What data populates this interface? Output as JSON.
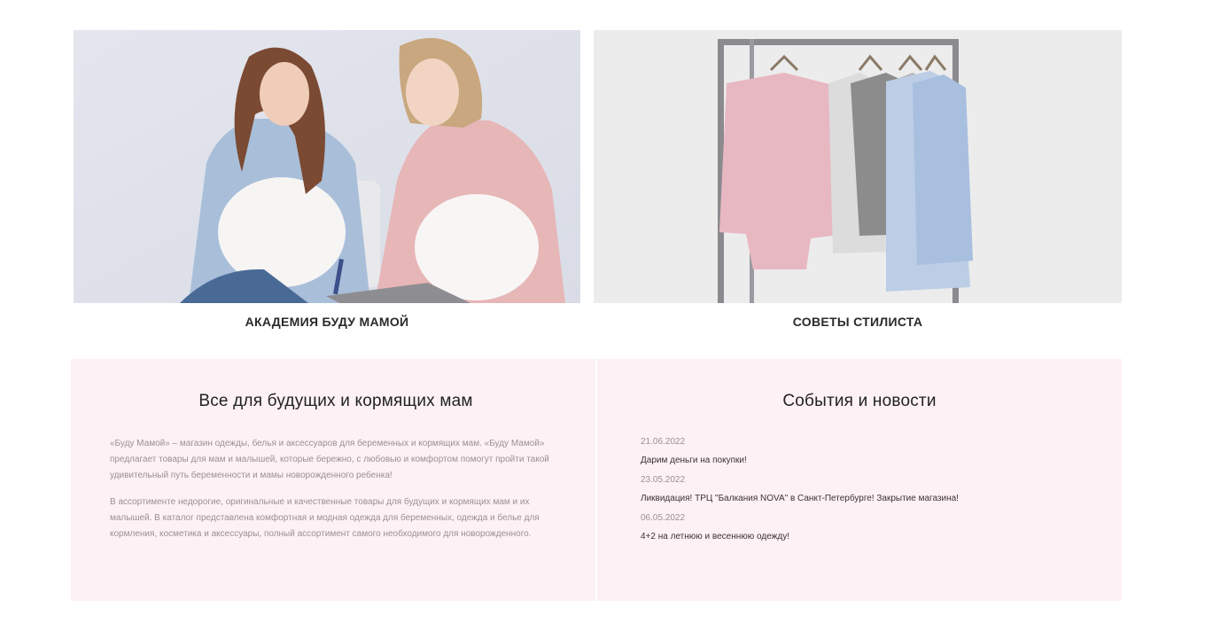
{
  "promos": [
    {
      "caption": "АКАДЕМИЯ БУДУ МАМОЙ",
      "image": "two-pregnant-women-photo"
    },
    {
      "caption": "СОВЕТЫ СТИЛИСТА",
      "image": "clothes-rack-photo"
    }
  ],
  "about": {
    "title": "Все для будущих и кормящих мам",
    "paragraphs": [
      "«Буду Мамой» – магазин одежды, белья и аксессуаров для беременных и кормящих мам. «Буду Мамой» предлагает товары для мам и малышей, которые бережно, с любовью и комфортом помогут пройти такой удивительный путь беременности и мамы новорожденного ребенка!",
      "В ассортименте недорогие, оригинальные и качественные товары для будущих и кормящих мам и их малышей. В каталог представлена комфортная и модная одежда для беременных, одежда и белье для кормления, косметика и аксессуары, полный ассортимент самого необходимого для новорожденного."
    ]
  },
  "news": {
    "title": "События и новости",
    "items": [
      {
        "date": "21.06.2022",
        "title": "Дарим деньги на покупки!"
      },
      {
        "date": "23.05.2022",
        "title": "Ликвидация! ТРЦ \"Балкания NOVA\" в Санкт-Петербурге! Закрытие магазина!"
      },
      {
        "date": "06.05.2022",
        "title": "4+2 на летнюю и весеннюю одежду!"
      }
    ]
  },
  "colors": {
    "panel_bg": "#fdf1f5",
    "caption_text": "#2a2a2a",
    "muted_text": "#9a8f94"
  }
}
